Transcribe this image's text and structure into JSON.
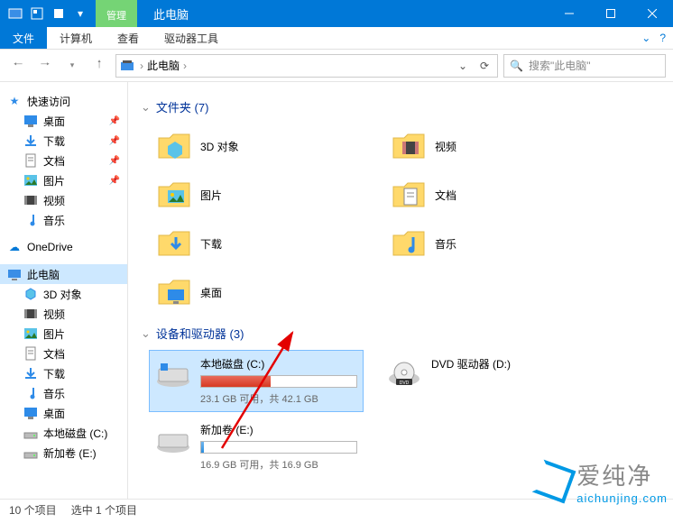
{
  "titlebar": {
    "context_tab": "管理",
    "title": "此电脑"
  },
  "ribbon": {
    "file": "文件",
    "tabs": [
      "计算机",
      "查看"
    ],
    "context_tabs": [
      "驱动器工具"
    ]
  },
  "nav": {
    "location": "此电脑",
    "search_placeholder": "搜索\"此电脑\""
  },
  "sidebar": {
    "quick_access": "快速访问",
    "quick_items": [
      {
        "label": "桌面",
        "icon": "desktop",
        "pinned": true
      },
      {
        "label": "下载",
        "icon": "download",
        "pinned": true
      },
      {
        "label": "文档",
        "icon": "document",
        "pinned": true
      },
      {
        "label": "图片",
        "icon": "picture",
        "pinned": true
      },
      {
        "label": "视频",
        "icon": "video",
        "pinned": false
      },
      {
        "label": "音乐",
        "icon": "music",
        "pinned": false
      }
    ],
    "onedrive": "OneDrive",
    "this_pc": "此电脑",
    "pc_items": [
      {
        "label": "3D 对象",
        "icon": "3d"
      },
      {
        "label": "视频",
        "icon": "video"
      },
      {
        "label": "图片",
        "icon": "picture"
      },
      {
        "label": "文档",
        "icon": "document"
      },
      {
        "label": "下载",
        "icon": "download"
      },
      {
        "label": "音乐",
        "icon": "music"
      },
      {
        "label": "桌面",
        "icon": "desktop"
      },
      {
        "label": "本地磁盘 (C:)",
        "icon": "drive"
      },
      {
        "label": "新加卷 (E:)",
        "icon": "drive"
      }
    ]
  },
  "content": {
    "folders_header": "文件夹 (7)",
    "folders": [
      {
        "label": "3D 对象",
        "icon": "3d"
      },
      {
        "label": "视频",
        "icon": "video"
      },
      {
        "label": "图片",
        "icon": "picture"
      },
      {
        "label": "文档",
        "icon": "document"
      },
      {
        "label": "下载",
        "icon": "download"
      },
      {
        "label": "音乐",
        "icon": "music"
      },
      {
        "label": "桌面",
        "icon": "desktop"
      }
    ],
    "drives_header": "设备和驱动器 (3)",
    "drives": [
      {
        "name": "本地磁盘 (C:)",
        "free": "23.1 GB",
        "total": "42.1 GB",
        "sub": "23.1 GB 可用，共 42.1 GB",
        "fill_pct": 45,
        "red": true,
        "selected": true,
        "type": "hdd"
      },
      {
        "name": "新加卷 (E:)",
        "free": "16.9 GB",
        "total": "16.9 GB",
        "sub": "16.9 GB 可用，共 16.9 GB",
        "fill_pct": 2,
        "red": false,
        "selected": false,
        "type": "hdd"
      }
    ],
    "dvd": {
      "name": "DVD 驱动器 (D:)"
    }
  },
  "statusbar": {
    "items": "10 个项目",
    "selected": "选中 1 个项目"
  },
  "watermark": {
    "text": "爱纯净",
    "url": "aichunjing.com"
  }
}
